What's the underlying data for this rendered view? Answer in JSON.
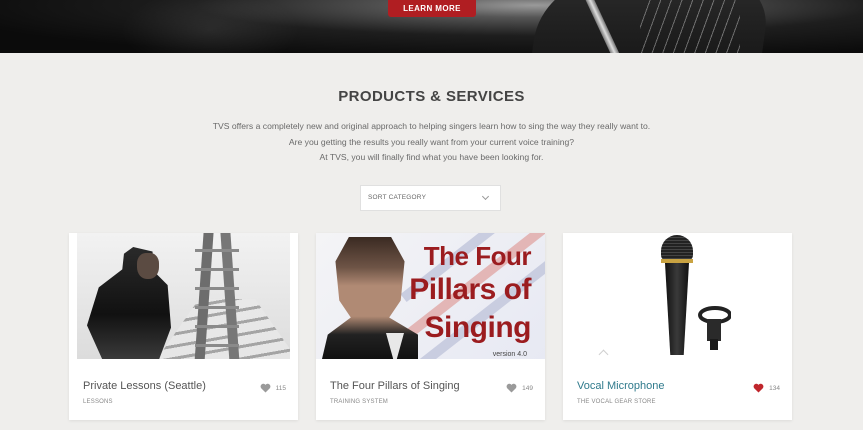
{
  "hero": {
    "button_label": "LEARN MORE"
  },
  "section": {
    "title": "PRODUCTS & SERVICES",
    "intro_lines": [
      "TVS offers a completely new and original approach to helping singers learn how to sing the way they really want to.",
      "Are you getting the results you really want from your current voice training?",
      "At TVS, you will finally find what you have been looking for."
    ]
  },
  "sort": {
    "selected": "SORT CATEGORY"
  },
  "cards": [
    {
      "title": "Private Lessons (Seattle)",
      "category": "LESSONS",
      "likes": "115",
      "liked": false,
      "heart_color": "#9a9a9a"
    },
    {
      "title": "The Four Pillars of Singing",
      "category": "TRAINING SYSTEM",
      "likes": "149",
      "liked": false,
      "heart_color": "#9a9a9a",
      "cover": {
        "line1": "The Four",
        "line2": "Pillars of",
        "line3": "Singing",
        "version": "version 4.0"
      }
    },
    {
      "title": "Vocal Microphone",
      "category": "THE VOCAL GEAR STORE",
      "likes": "134",
      "liked": true,
      "heart_color": "#c0262c"
    }
  ],
  "colors": {
    "accent": "#b01e22",
    "link_teal": "#2f7a8c",
    "background": "#efeeec"
  }
}
